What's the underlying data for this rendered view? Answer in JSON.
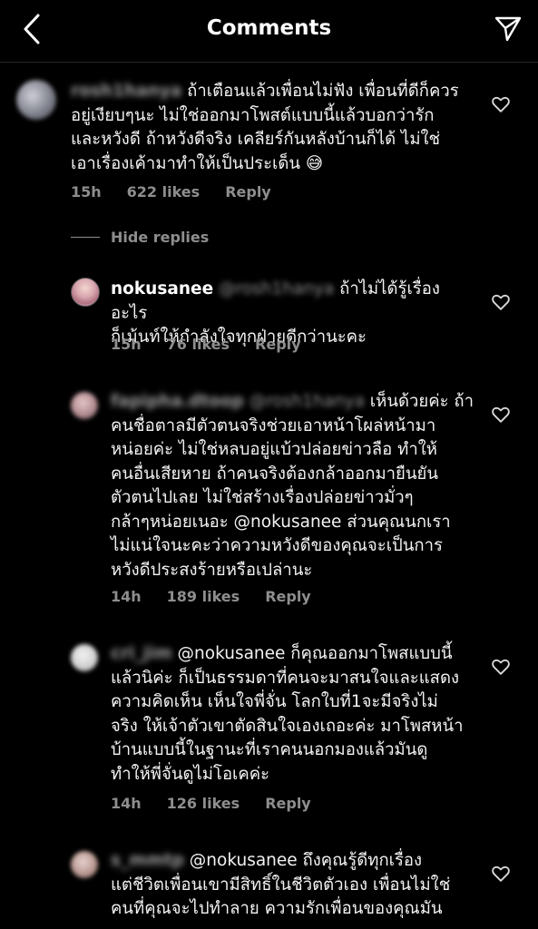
{
  "header": {
    "title": "Comments",
    "back_icon": "chevron-left-icon",
    "send_icon": "paper-plane-icon"
  },
  "comments": [
    {
      "username": "rosh1hanya",
      "text": "ถ้าเตือนแล้วเพื่อนไม่ฟัง เพื่อนที่ดีก็ควร\nอยู่เงียบๆนะ ไม่ใช่ออกมาโพสต์แบบนี้แล้วบอกว่ารัก\nและหวังดี ถ้าหวังดีจริง เคลียร์กันหลังบ้านก็ได้ ไม่ใช่\nเอาเรื่องเค้ามาทำให้เป็นประเด็น 😅",
      "time": "15h",
      "likes": "622 likes",
      "reply": "Reply"
    },
    {
      "username": "nokusanee",
      "mention": "@rosh1hanya",
      "text": " ถ้าไม่ได้รู้เรื่องอะไร\nก็เม้นท์ให้กำลังใจทุกฝ่ายดีกว่านะคะ",
      "time": "15h",
      "likes": "76 likes",
      "reply": "Reply"
    },
    {
      "username": "fapipha.dtoop",
      "mention": "@rosh1hanya",
      "text": " เห็นด้วยค่ะ ถ้า\nคนชื่อตาลมีตัวตนจริงช่วยเอาหน้าโผล่หน้ามา\nหน่อยค่ะ ไม่ใช่หลบอยู่แบ้วปล่อยข่าวลือ ทำให้\nคนอื่นเสียหาย ถ้าคนจริงต้องกล้าออกมายืนยัน\nตัวตนไปเลย ไม่ใช่สร้างเรื่องปล่อยข่าวมั่วๆ\nกล้าๆหน่อยเนอะ @nokusanee ส่วนคุณนกเรา\nไม่แน่ใจนะคะว่าความหวังดีของคุณจะเป็นการ\nหวังดีประสงร้ายหรือเปล่านะ",
      "time": "14h",
      "likes": "189 likes",
      "reply": "Reply"
    },
    {
      "username": "cri_jim",
      "text": "@nokusanee ก็คุณออกมาโพสแบบนี้\nแล้วนิค่ะ ก็เป็นธรรมดาที่คนจะมาสนใจและแสดง\nความคิดเห็น เห็นใจพี่จั่น โลกใบที่1จะมีจริงไม่\nจริง ให้เจ้าตัวเขาตัดสินใจเองเถอะค่ะ มาโพสหน้า\nบ้านแบบนี้ในฐานะที่เราคนนอกมองแล้วมันดู\nทำให้พี่จั่นดูไม่โอเคค่ะ",
      "time": "14h",
      "likes": "126 likes",
      "reply": "Reply"
    },
    {
      "username": "s_mmtp",
      "text": "@nokusanee ถึงคุณรู้ดีทุกเรื่อง\nแต่ชีวิตเพื่อนเขามีสิทธิ์ในชีวิตตัวเอง เพื่อนไม่ใช่\nคนที่คุณจะไปทำลาย ความรักเพื่อนของคุณมัน"
    }
  ],
  "hide_replies": "Hide replies",
  "heart_icon": "heart-outline-icon",
  "colors": {
    "background": "#000000",
    "text": "#f5f5f5",
    "meta": "#8e8e8e",
    "divider": "#262626"
  }
}
